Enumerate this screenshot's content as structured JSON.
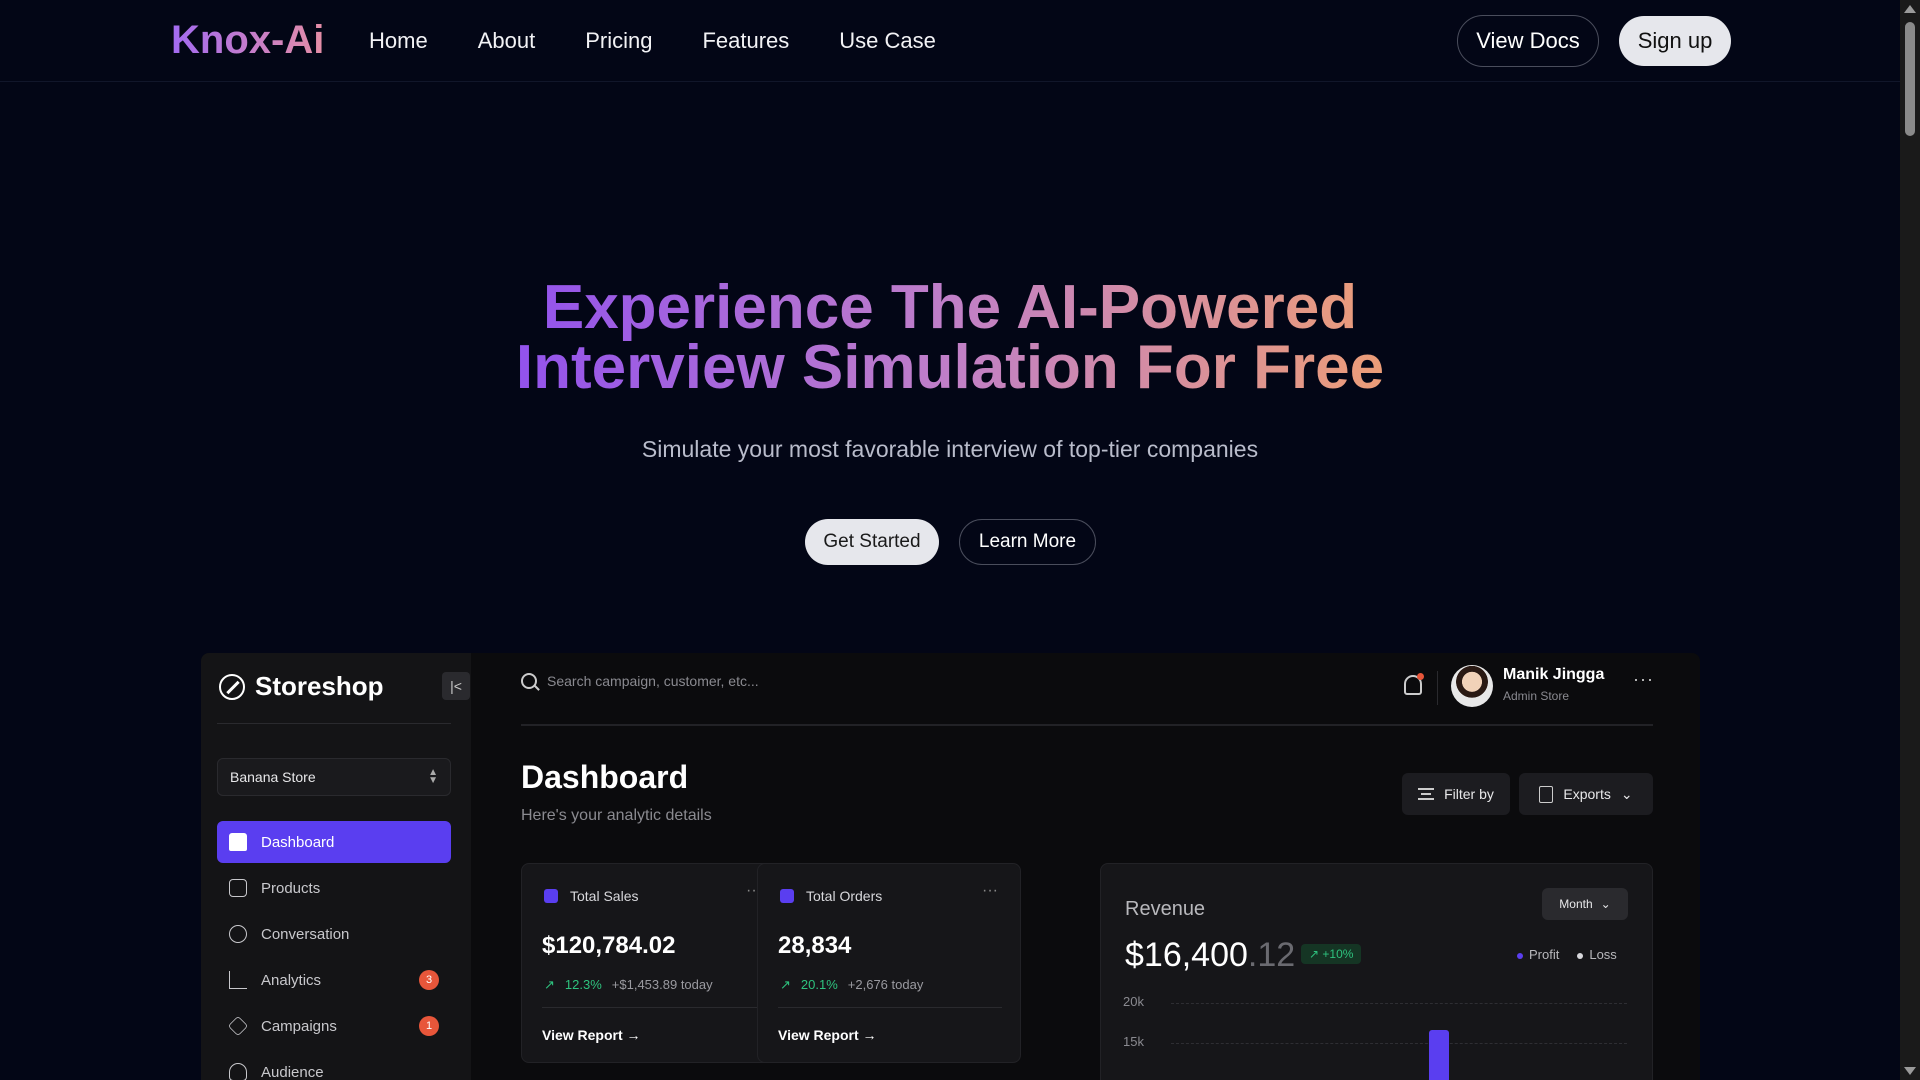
{
  "nav": {
    "logo": "Knox-Ai",
    "links": [
      "Home",
      "About",
      "Pricing",
      "Features",
      "Use Case"
    ],
    "docs_label": "View Docs",
    "signup_label": "Sign up"
  },
  "hero": {
    "title_line1": "Experience The AI-Powered",
    "title_line2": "Interview Simulation For Free",
    "subtitle": "Simulate your most favorable interview of top-tier companies",
    "primary_label": "Get Started",
    "secondary_label": "Learn More"
  },
  "preview": {
    "brand": "Storeshop",
    "store_selector": "Banana Store",
    "menu": [
      {
        "label": "Dashboard",
        "badge": ""
      },
      {
        "label": "Products",
        "badge": ""
      },
      {
        "label": "Conversation",
        "badge": ""
      },
      {
        "label": "Analytics",
        "badge": "3"
      },
      {
        "label": "Campaigns",
        "badge": "1"
      },
      {
        "label": "Audience",
        "badge": ""
      }
    ],
    "search_placeholder": "Search campaign, customer, etc...",
    "user": {
      "name": "Manik Jingga",
      "role": "Admin Store"
    },
    "title": "Dashboard",
    "subtitle": "Here's your analytic details",
    "filter_label": "Filter by",
    "export_label": "Exports",
    "cards": [
      {
        "title": "Total Sales",
        "value": "$120,784.02",
        "delta": "12.3%",
        "delta_note": "+$1,453.89 today",
        "link": "View Report"
      },
      {
        "title": "Total Orders",
        "value": "28,834",
        "delta": "20.1%",
        "delta_note": "+2,676 today",
        "link": "View Report"
      }
    ],
    "revenue": {
      "title": "Revenue",
      "value_main": "$16,400",
      "value_decimal": ".12",
      "delta": "+10%",
      "period": "Month",
      "legend": [
        "Profit",
        "Loss"
      ],
      "y_ticks": [
        "20k",
        "15k"
      ]
    }
  },
  "colors": {
    "accent": "#5a3ef0",
    "positive": "#2ec27e",
    "badge": "#e8563a",
    "background": "#030616"
  }
}
